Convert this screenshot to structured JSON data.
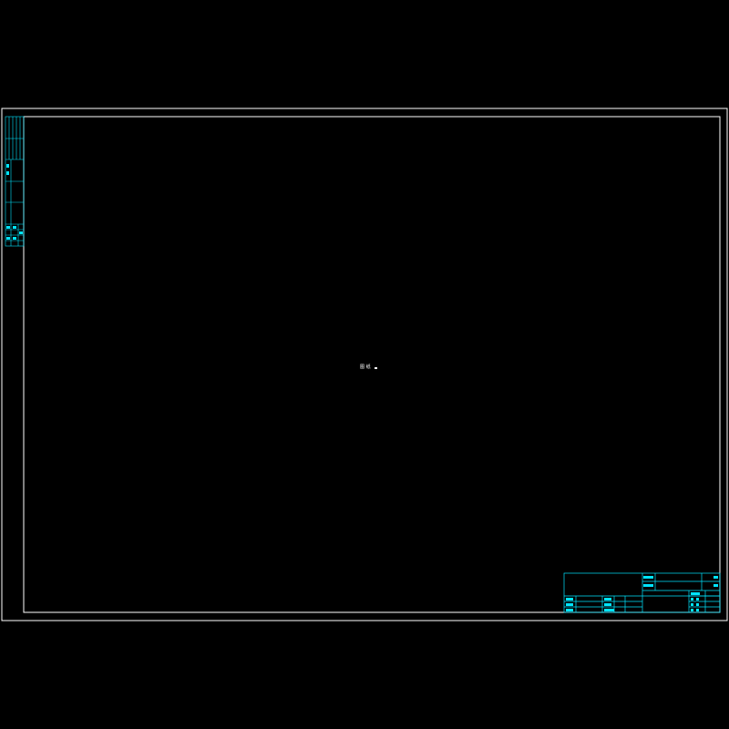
{
  "colors": {
    "background": "#000000",
    "frame": "#ffffff",
    "title_block": "#00e5ff",
    "center_mark": "#ffffff"
  },
  "center_note": {
    "text": "图 纸"
  },
  "side_strip": {
    "labels": [
      "",
      "",
      ""
    ]
  },
  "title_block": {
    "cells": [
      {
        "id": "tb-r1c1",
        "text": ""
      },
      {
        "id": "tb-r1c2",
        "text": ""
      },
      {
        "id": "tb-r2c1",
        "text": ""
      },
      {
        "id": "tb-r2c2",
        "text": ""
      }
    ]
  }
}
